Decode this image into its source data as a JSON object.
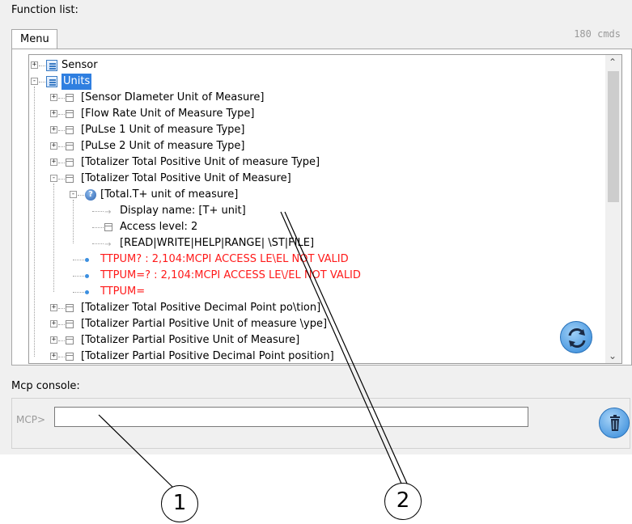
{
  "function_list": {
    "label": "Function list:",
    "tab_label": "Menu",
    "cmd_count": "180 cmds",
    "tree": [
      {
        "text": "Sensor",
        "icon": "list-icon",
        "expander": "+"
      },
      {
        "text": "Units",
        "icon": "list-icon",
        "expander": "-",
        "selected": true
      },
      {
        "text": "[Sensor DIameter Unit of Measure]",
        "icon": "page-icon",
        "expander": "+"
      },
      {
        "text": "[Flow Rate Unit of Measure Type]",
        "icon": "page-icon",
        "expander": "+"
      },
      {
        "text": "[PuLse 1 Unit of measure Type]",
        "icon": "page-icon",
        "expander": "+"
      },
      {
        "text": "[PuLse 2 Unit of measure Type]",
        "icon": "page-icon",
        "expander": "+"
      },
      {
        "text": "[Totalizer Total Positive Unit of measure Type]",
        "icon": "page-icon",
        "expander": "+"
      },
      {
        "text": "[Totalizer Total Positive Unit of Measure]",
        "icon": "page-icon",
        "expander": "-"
      },
      {
        "text": "[Total.T+ unit of measure]",
        "icon": "question-icon",
        "expander": "-"
      },
      {
        "text": "Display name: [T+ unit]",
        "icon": "arrow-icon"
      },
      {
        "text": "Access level: 2",
        "icon": "page-icon"
      },
      {
        "text": "[READ|WRITE|HELP|RANGE| \\ST|FILE]",
        "icon": "arrow-icon"
      },
      {
        "text": "TTPUM? : 2,104:MCPI ACCESS LE\\EL NOT VALID",
        "icon": "dot-icon",
        "error": true
      },
      {
        "text": "TTPUM=? : 2,104:MCPI ACCESS LE\\/EL NOT VALID",
        "icon": "dot-icon",
        "error": true
      },
      {
        "text": "TTPUM=",
        "icon": "dot-icon",
        "error": true
      },
      {
        "text": "[Totalizer Total Positive Decimal Point po\\tion]",
        "icon": "page-icon",
        "expander": "+"
      },
      {
        "text": "[Totalizer Partial Positive Unit of measure \\ype]",
        "icon": "page-icon",
        "expander": "+"
      },
      {
        "text": "[Totalizer Partial Positive Unit of Measure]",
        "icon": "page-icon",
        "expander": "+"
      },
      {
        "text": "[Totalizer Partial Positive Decimal Point position]",
        "icon": "page-icon",
        "expander": "+"
      }
    ],
    "refresh_icon": "refresh-icon"
  },
  "console": {
    "label": "Mcp console:",
    "prompt": "MCP>",
    "input_value": "",
    "trash_icon": "trash-icon"
  },
  "callouts": [
    "1",
    "2"
  ],
  "colors": {
    "selection": "#2f7fe0",
    "error_text": "#ff1a1a",
    "panel_bg": "#f0f0f0",
    "icon_blue": "#2f86d8"
  }
}
